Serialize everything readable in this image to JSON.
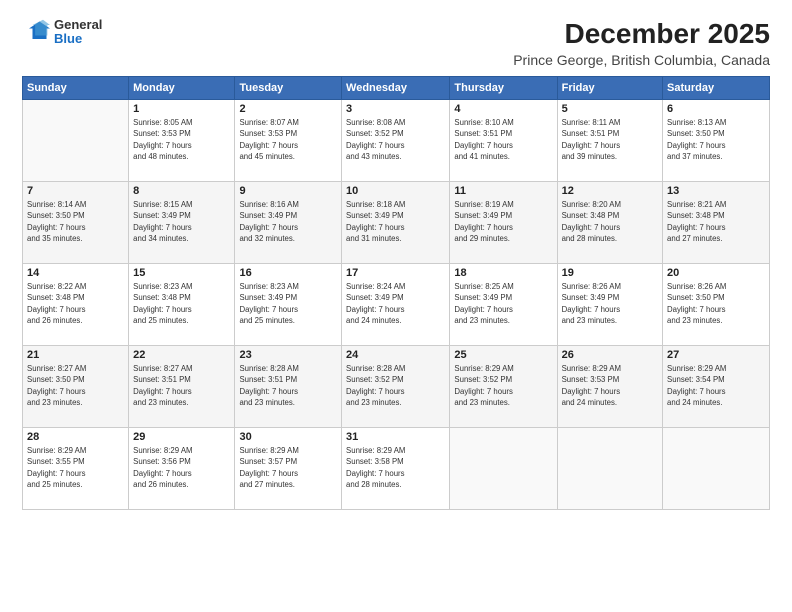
{
  "logo": {
    "general": "General",
    "blue": "Blue"
  },
  "header": {
    "month_year": "December 2025",
    "location": "Prince George, British Columbia, Canada"
  },
  "weekdays": [
    "Sunday",
    "Monday",
    "Tuesday",
    "Wednesday",
    "Thursday",
    "Friday",
    "Saturday"
  ],
  "weeks": [
    [
      {
        "day": "",
        "info": ""
      },
      {
        "day": "1",
        "info": "Sunrise: 8:05 AM\nSunset: 3:53 PM\nDaylight: 7 hours\nand 48 minutes."
      },
      {
        "day": "2",
        "info": "Sunrise: 8:07 AM\nSunset: 3:53 PM\nDaylight: 7 hours\nand 45 minutes."
      },
      {
        "day": "3",
        "info": "Sunrise: 8:08 AM\nSunset: 3:52 PM\nDaylight: 7 hours\nand 43 minutes."
      },
      {
        "day": "4",
        "info": "Sunrise: 8:10 AM\nSunset: 3:51 PM\nDaylight: 7 hours\nand 41 minutes."
      },
      {
        "day": "5",
        "info": "Sunrise: 8:11 AM\nSunset: 3:51 PM\nDaylight: 7 hours\nand 39 minutes."
      },
      {
        "day": "6",
        "info": "Sunrise: 8:13 AM\nSunset: 3:50 PM\nDaylight: 7 hours\nand 37 minutes."
      }
    ],
    [
      {
        "day": "7",
        "info": "Sunrise: 8:14 AM\nSunset: 3:50 PM\nDaylight: 7 hours\nand 35 minutes."
      },
      {
        "day": "8",
        "info": "Sunrise: 8:15 AM\nSunset: 3:49 PM\nDaylight: 7 hours\nand 34 minutes."
      },
      {
        "day": "9",
        "info": "Sunrise: 8:16 AM\nSunset: 3:49 PM\nDaylight: 7 hours\nand 32 minutes."
      },
      {
        "day": "10",
        "info": "Sunrise: 8:18 AM\nSunset: 3:49 PM\nDaylight: 7 hours\nand 31 minutes."
      },
      {
        "day": "11",
        "info": "Sunrise: 8:19 AM\nSunset: 3:49 PM\nDaylight: 7 hours\nand 29 minutes."
      },
      {
        "day": "12",
        "info": "Sunrise: 8:20 AM\nSunset: 3:48 PM\nDaylight: 7 hours\nand 28 minutes."
      },
      {
        "day": "13",
        "info": "Sunrise: 8:21 AM\nSunset: 3:48 PM\nDaylight: 7 hours\nand 27 minutes."
      }
    ],
    [
      {
        "day": "14",
        "info": "Sunrise: 8:22 AM\nSunset: 3:48 PM\nDaylight: 7 hours\nand 26 minutes."
      },
      {
        "day": "15",
        "info": "Sunrise: 8:23 AM\nSunset: 3:48 PM\nDaylight: 7 hours\nand 25 minutes."
      },
      {
        "day": "16",
        "info": "Sunrise: 8:23 AM\nSunset: 3:49 PM\nDaylight: 7 hours\nand 25 minutes."
      },
      {
        "day": "17",
        "info": "Sunrise: 8:24 AM\nSunset: 3:49 PM\nDaylight: 7 hours\nand 24 minutes."
      },
      {
        "day": "18",
        "info": "Sunrise: 8:25 AM\nSunset: 3:49 PM\nDaylight: 7 hours\nand 23 minutes."
      },
      {
        "day": "19",
        "info": "Sunrise: 8:26 AM\nSunset: 3:49 PM\nDaylight: 7 hours\nand 23 minutes."
      },
      {
        "day": "20",
        "info": "Sunrise: 8:26 AM\nSunset: 3:50 PM\nDaylight: 7 hours\nand 23 minutes."
      }
    ],
    [
      {
        "day": "21",
        "info": "Sunrise: 8:27 AM\nSunset: 3:50 PM\nDaylight: 7 hours\nand 23 minutes."
      },
      {
        "day": "22",
        "info": "Sunrise: 8:27 AM\nSunset: 3:51 PM\nDaylight: 7 hours\nand 23 minutes."
      },
      {
        "day": "23",
        "info": "Sunrise: 8:28 AM\nSunset: 3:51 PM\nDaylight: 7 hours\nand 23 minutes."
      },
      {
        "day": "24",
        "info": "Sunrise: 8:28 AM\nSunset: 3:52 PM\nDaylight: 7 hours\nand 23 minutes."
      },
      {
        "day": "25",
        "info": "Sunrise: 8:29 AM\nSunset: 3:52 PM\nDaylight: 7 hours\nand 23 minutes."
      },
      {
        "day": "26",
        "info": "Sunrise: 8:29 AM\nSunset: 3:53 PM\nDaylight: 7 hours\nand 24 minutes."
      },
      {
        "day": "27",
        "info": "Sunrise: 8:29 AM\nSunset: 3:54 PM\nDaylight: 7 hours\nand 24 minutes."
      }
    ],
    [
      {
        "day": "28",
        "info": "Sunrise: 8:29 AM\nSunset: 3:55 PM\nDaylight: 7 hours\nand 25 minutes."
      },
      {
        "day": "29",
        "info": "Sunrise: 8:29 AM\nSunset: 3:56 PM\nDaylight: 7 hours\nand 26 minutes."
      },
      {
        "day": "30",
        "info": "Sunrise: 8:29 AM\nSunset: 3:57 PM\nDaylight: 7 hours\nand 27 minutes."
      },
      {
        "day": "31",
        "info": "Sunrise: 8:29 AM\nSunset: 3:58 PM\nDaylight: 7 hours\nand 28 minutes."
      },
      {
        "day": "",
        "info": ""
      },
      {
        "day": "",
        "info": ""
      },
      {
        "day": "",
        "info": ""
      }
    ]
  ]
}
